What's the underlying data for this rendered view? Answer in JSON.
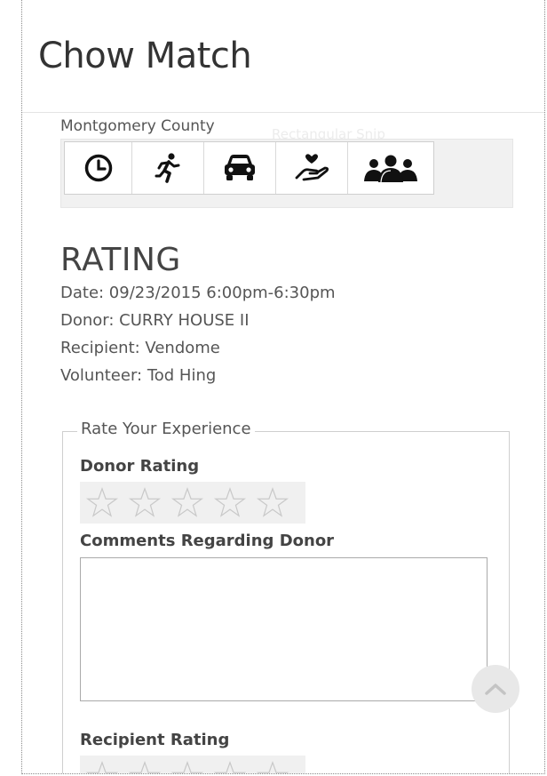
{
  "app": {
    "title": "Chow Match"
  },
  "location": {
    "county": "Montgomery County",
    "ghost_text": "Rectangular Snip"
  },
  "toolbar": {
    "buttons": [
      {
        "icon": "clock-icon"
      },
      {
        "icon": "running-person-icon"
      },
      {
        "icon": "car-icon"
      },
      {
        "icon": "hand-heart-icon"
      },
      {
        "icon": "group-people-icon"
      }
    ]
  },
  "rating": {
    "heading": "RATING",
    "date": "Date: 09/23/2015 6:00pm-6:30pm",
    "donor": "Donor: CURRY HOUSE II",
    "recipient": "Recipient: Vendome",
    "volunteer": "Volunteer: Tod Hing"
  },
  "form": {
    "legend": "Rate Your Experience",
    "donor_rating_label": "Donor Rating",
    "donor_rating_value": 0,
    "donor_comments_label": "Comments Regarding Donor",
    "donor_comments_value": "",
    "recipient_rating_label": "Recipient Rating",
    "recipient_rating_value": 0,
    "max_stars": 5
  },
  "colors": {
    "star_outline": "#c9c9c9",
    "icon": "#111111"
  }
}
